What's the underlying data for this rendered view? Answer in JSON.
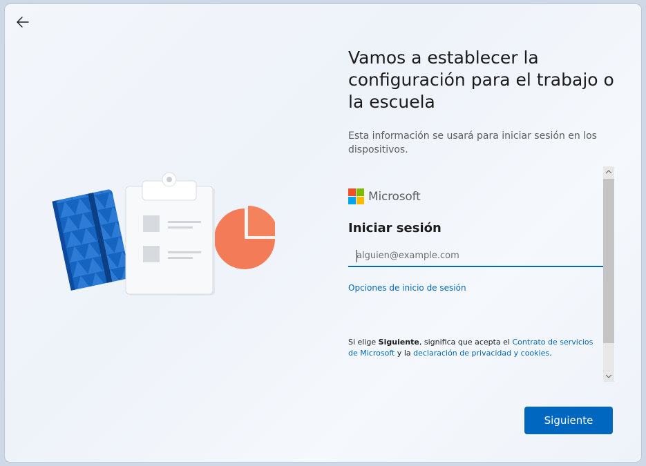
{
  "header": {
    "back_icon": "arrow-left-icon"
  },
  "main": {
    "title": "Vamos a establecer la configuración para el trabajo o la escuela",
    "subtitle": "Esta información se usará para iniciar sesión en los dispositivos."
  },
  "signin": {
    "logo_text": "Microsoft",
    "logo_colors": [
      "#f25022",
      "#7fba00",
      "#00a4ef",
      "#ffb900"
    ],
    "heading": "Iniciar sesión",
    "email_placeholder": "alguien@example.com",
    "email_value": "",
    "options_link": "Opciones de inicio de sesión",
    "terms": {
      "prefix": "Si elige ",
      "bold": "Siguiente",
      "mid": ", significa que acepta el ",
      "link1": "Contrato de servicios de Microsoft",
      "conj": " y la ",
      "link2": "declaración de privacidad y cookies",
      "suffix": "."
    }
  },
  "footer": {
    "next_label": "Siguiente"
  },
  "colors": {
    "accent": "#0067c0",
    "link": "#0067b8"
  }
}
